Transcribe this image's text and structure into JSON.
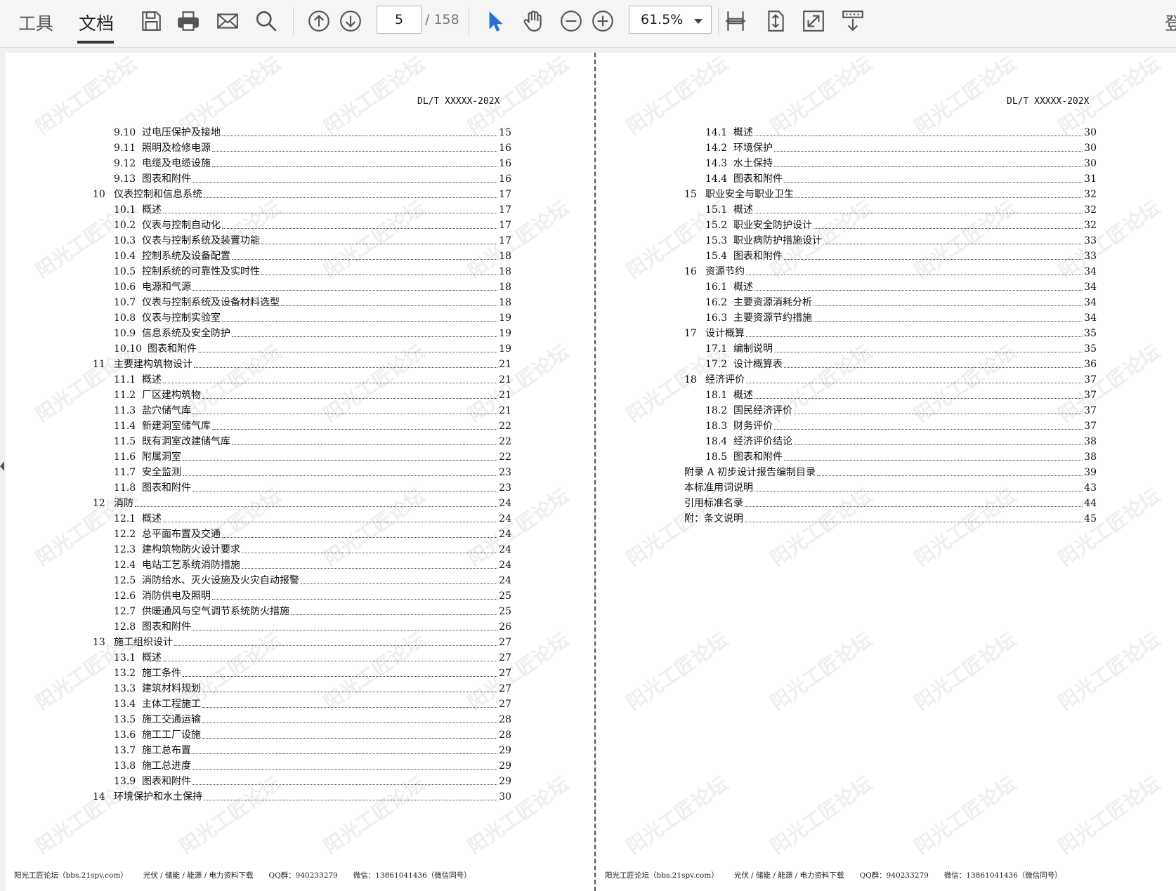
{
  "toolbar": {
    "tab_tools": "工具",
    "tab_document": "文档",
    "current_page": "5",
    "total_pages": "/ 158",
    "zoom": "61.5%",
    "login_char": "登"
  },
  "left_page": {
    "header": "DL/T XXXXX-202X",
    "toc": [
      {
        "num": "9.10",
        "title": "过电压保护及接地",
        "page": "15",
        "level": 2
      },
      {
        "num": "9.11",
        "title": "照明及检修电源",
        "page": "16",
        "level": 2
      },
      {
        "num": "9.12",
        "title": "电缆及电缆设施",
        "page": "16",
        "level": 2
      },
      {
        "num": "9.13",
        "title": "图表和附件",
        "page": "16",
        "level": 2
      },
      {
        "num": "10",
        "title": "仪表控制和信息系统",
        "page": "17",
        "level": 1
      },
      {
        "num": "10.1",
        "title": "概述",
        "page": "17",
        "level": 2
      },
      {
        "num": "10.2",
        "title": "仪表与控制自动化",
        "page": "17",
        "level": 2
      },
      {
        "num": "10.3",
        "title": "仪表与控制系统及装置功能",
        "page": "17",
        "level": 2
      },
      {
        "num": "10.4",
        "title": "控制系统及设备配置",
        "page": "18",
        "level": 2
      },
      {
        "num": "10.5",
        "title": "控制系统的可靠性及实时性",
        "page": "18",
        "level": 2
      },
      {
        "num": "10.6",
        "title": "电源和气源",
        "page": "18",
        "level": 2
      },
      {
        "num": "10.7",
        "title": "仪表与控制系统及设备材料选型",
        "page": "18",
        "level": 2
      },
      {
        "num": "10.8",
        "title": "仪表与控制实验室",
        "page": "19",
        "level": 2
      },
      {
        "num": "10.9",
        "title": "信息系统及安全防护",
        "page": "19",
        "level": 2
      },
      {
        "num": "10.10",
        "title": "图表和附件",
        "page": "19",
        "level": 2
      },
      {
        "num": "11",
        "title": "主要建构筑物设计",
        "page": "21",
        "level": 1
      },
      {
        "num": "11.1",
        "title": "概述",
        "page": "21",
        "level": 2
      },
      {
        "num": "11.2",
        "title": "厂区建构筑物",
        "page": "21",
        "level": 2
      },
      {
        "num": "11.3",
        "title": "盐穴储气库",
        "page": "21",
        "level": 2
      },
      {
        "num": "11.4",
        "title": "新建洞室储气库",
        "page": "22",
        "level": 2
      },
      {
        "num": "11.5",
        "title": "既有洞室改建储气库",
        "page": "22",
        "level": 2
      },
      {
        "num": "11.6",
        "title": "附属洞室",
        "page": "22",
        "level": 2
      },
      {
        "num": "11.7",
        "title": "安全监测",
        "page": "23",
        "level": 2
      },
      {
        "num": "11.8",
        "title": "图表和附件",
        "page": "23",
        "level": 2
      },
      {
        "num": "12",
        "title": "消防",
        "page": "24",
        "level": 1
      },
      {
        "num": "12.1",
        "title": "概述",
        "page": "24",
        "level": 2
      },
      {
        "num": "12.2",
        "title": "总平面布置及交通",
        "page": "24",
        "level": 2
      },
      {
        "num": "12.3",
        "title": "建构筑物防火设计要求",
        "page": "24",
        "level": 2
      },
      {
        "num": "12.4",
        "title": "电站工艺系统消防措施",
        "page": "24",
        "level": 2
      },
      {
        "num": "12.5",
        "title": "消防给水、灭火设施及火灾自动报警",
        "page": "24",
        "level": 2
      },
      {
        "num": "12.6",
        "title": "消防供电及照明",
        "page": "25",
        "level": 2
      },
      {
        "num": "12.7",
        "title": "供暖通风与空气调节系统防火措施",
        "page": "25",
        "level": 2
      },
      {
        "num": "12.8",
        "title": "图表和附件",
        "page": "26",
        "level": 2
      },
      {
        "num": "13",
        "title": "施工组织设计",
        "page": "27",
        "level": 1
      },
      {
        "num": "13.1",
        "title": "概述",
        "page": "27",
        "level": 2
      },
      {
        "num": "13.2",
        "title": "施工条件",
        "page": "27",
        "level": 2
      },
      {
        "num": "13.3",
        "title": "建筑材料规划",
        "page": "27",
        "level": 2
      },
      {
        "num": "13.4",
        "title": "主体工程施工",
        "page": "27",
        "level": 2
      },
      {
        "num": "13.5",
        "title": "施工交通运输",
        "page": "28",
        "level": 2
      },
      {
        "num": "13.6",
        "title": "施工工厂设施",
        "page": "28",
        "level": 2
      },
      {
        "num": "13.7",
        "title": "施工总布置",
        "page": "29",
        "level": 2
      },
      {
        "num": "13.8",
        "title": "施工总进度",
        "page": "29",
        "level": 2
      },
      {
        "num": "13.9",
        "title": "图表和附件",
        "page": "29",
        "level": 2
      },
      {
        "num": "14",
        "title": "环境保护和水土保持",
        "page": "30",
        "level": 1
      }
    ],
    "footer": [
      "阳光工匠论坛（bbs.21spv.com）",
      "光伏 / 储能 / 能源 / 电力资料下载",
      "QQ群：940233279",
      "微信：13861041436（微信同号）"
    ]
  },
  "right_page": {
    "header": "DL/T XXXXX-202X",
    "toc": [
      {
        "num": "14.1",
        "title": "概述",
        "page": "30",
        "level": 2
      },
      {
        "num": "14.2",
        "title": "环境保护",
        "page": "30",
        "level": 2
      },
      {
        "num": "14.3",
        "title": "水土保持",
        "page": "30",
        "level": 2
      },
      {
        "num": "14.4",
        "title": "图表和附件",
        "page": "31",
        "level": 2
      },
      {
        "num": "15",
        "title": "职业安全与职业卫生",
        "page": "32",
        "level": 1
      },
      {
        "num": "15.1",
        "title": "概述",
        "page": "32",
        "level": 2
      },
      {
        "num": "15.2",
        "title": "职业安全防护设计",
        "page": "32",
        "level": 2
      },
      {
        "num": "15.3",
        "title": "职业病防护措施设计",
        "page": "33",
        "level": 2
      },
      {
        "num": "15.4",
        "title": "图表和附件",
        "page": "33",
        "level": 2
      },
      {
        "num": "16",
        "title": "资源节约",
        "page": "34",
        "level": 1
      },
      {
        "num": "16.1",
        "title": "概述",
        "page": "34",
        "level": 2
      },
      {
        "num": "16.2",
        "title": "主要资源消耗分析",
        "page": "34",
        "level": 2
      },
      {
        "num": "16.3",
        "title": "主要资源节约措施",
        "page": "34",
        "level": 2
      },
      {
        "num": "17",
        "title": "设计概算",
        "page": "35",
        "level": 1
      },
      {
        "num": "17.1",
        "title": "编制说明",
        "page": "35",
        "level": 2
      },
      {
        "num": "17.2",
        "title": "设计概算表",
        "page": "36",
        "level": 2
      },
      {
        "num": "18",
        "title": "经济评价",
        "page": "37",
        "level": 1
      },
      {
        "num": "18.1",
        "title": "概述",
        "page": "37",
        "level": 2
      },
      {
        "num": "18.2",
        "title": "国民经济评价",
        "page": "37",
        "level": 2
      },
      {
        "num": "18.3",
        "title": "财务评价",
        "page": "37",
        "level": 2
      },
      {
        "num": "18.4",
        "title": "经济评价结论",
        "page": "38",
        "level": 2
      },
      {
        "num": "18.5",
        "title": "图表和附件",
        "page": "38",
        "level": 2
      },
      {
        "num": "",
        "title": "附录 A 初步设计报告编制目录",
        "page": "39",
        "level": 0
      },
      {
        "num": "",
        "title": "本标准用词说明",
        "page": "43",
        "level": 0
      },
      {
        "num": "",
        "title": "引用标准名录",
        "page": "44",
        "level": 0
      },
      {
        "num": "",
        "title": "附：条文说明",
        "page": "45",
        "level": 0
      }
    ],
    "footer": [
      "阳光工匠论坛（bbs.21spv.com）",
      "光伏 / 储能 / 能源 / 电力资料下载",
      "QQ群：940233279",
      "微信：13861041436（微信同号）"
    ]
  },
  "watermark_text": "阳光工匠论坛",
  "icons": [
    "save-icon",
    "print-icon",
    "email-icon",
    "search-icon",
    "page-up-icon",
    "page-down-icon",
    "select-cursor-icon",
    "hand-tool-icon",
    "zoom-out-icon",
    "zoom-in-icon",
    "fit-width-icon",
    "fit-page-icon",
    "fullscreen-icon",
    "scroll-mode-icon"
  ],
  "colors": {
    "accent": "#2b6fd6",
    "icon": "#555555"
  }
}
